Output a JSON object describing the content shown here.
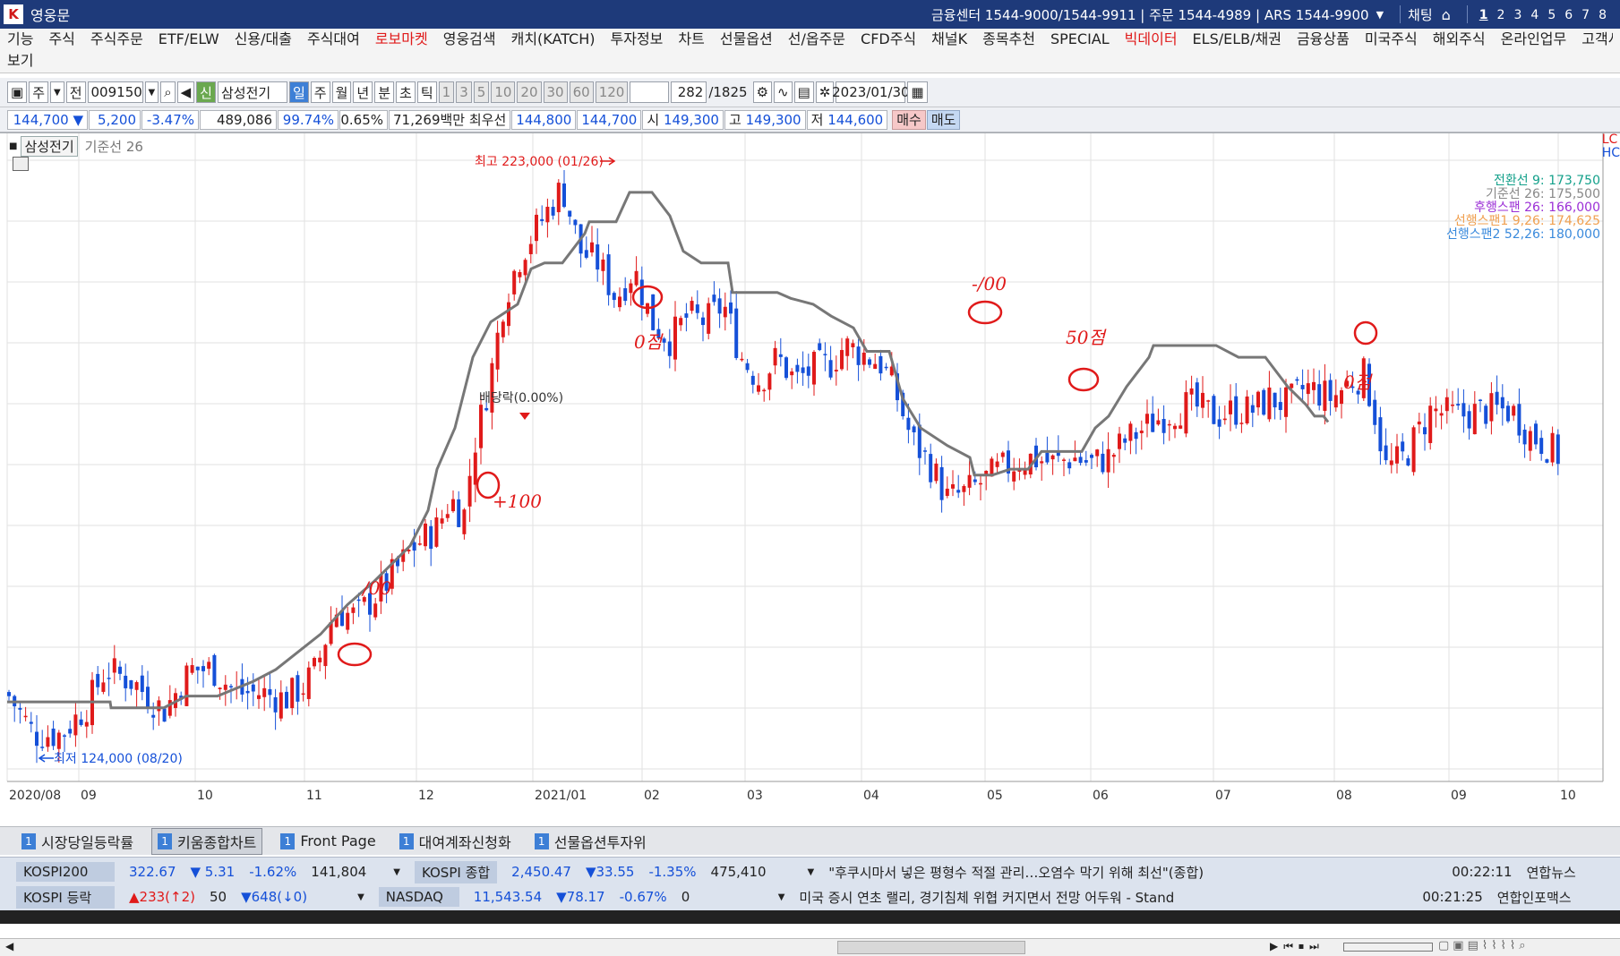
{
  "titlebar": {
    "app_icon": "kiwoom-logo-icon",
    "title": "영웅문",
    "center": "금융센터 1544-9000/1544-9911 | 주문 1544-4989 | ARS 1544-9900",
    "chat": "채팅",
    "home_icon": "home-icon",
    "screens": [
      "1",
      "2",
      "3",
      "4",
      "5",
      "6",
      "7",
      "8"
    ]
  },
  "menu": {
    "items": [
      "기능",
      "주식",
      "주식주문",
      "ETF/ELW",
      "신용/대출",
      "주식대여",
      "로보마켓",
      "영웅검색",
      "캐치(KATCH)",
      "투자정보",
      "차트",
      "선물옵션",
      "선/옵주문",
      "CFD주식",
      "채널K",
      "종목추천",
      "SPECIAL",
      "빅데이터",
      "ELS/ELB/채권",
      "금융상품",
      "미국주식",
      "해외주식",
      "온라인업무",
      "고객서비"
    ],
    "highlight": [
      "로보마켓",
      "빅데이터"
    ],
    "row2": "보기"
  },
  "toolbar": {
    "type": "주",
    "scope": "전",
    "code": "009150",
    "name": "삼성전기",
    "sin": "신",
    "periods": [
      "일",
      "주",
      "월",
      "년",
      "분",
      "초",
      "틱"
    ],
    "selected_period": "일",
    "intervals": [
      "1",
      "3",
      "5",
      "10",
      "20",
      "30",
      "60",
      "120"
    ],
    "count": "282",
    "total": "/1825",
    "date": "2023/01/30"
  },
  "quote": {
    "price": "144,700",
    "arrow": "▼",
    "change": "5,200",
    "pct": "-3.47%",
    "volume": "489,086",
    "ratio": "99.74%",
    "turnover": "0.65%",
    "amount": "71,269백만",
    "best_label": "최우선",
    "best_ask": "144,800",
    "best_bid": "144,700",
    "open_label": "시",
    "open": "149,300",
    "high_label": "고",
    "high": "149,300",
    "low_label": "저",
    "low": "144,600",
    "buy": "매수",
    "sell": "매도"
  },
  "chart_legend": {
    "name": "삼성전기",
    "indicator": "기준선 26"
  },
  "ichimoku": [
    {
      "label": "전환선 9: 173,750",
      "color": "#13a08a"
    },
    {
      "label": "기준선 26: 175,500",
      "color": "#888888"
    },
    {
      "label": "후행스팬 26: 166,000",
      "color": "#9b2fd6"
    },
    {
      "label": "선행스팬1 9,26: 174,625",
      "color": "#f0a050"
    },
    {
      "label": "선행스팬2 52,26: 180,000",
      "color": "#3a8adc"
    }
  ],
  "right_cut": [
    "LC",
    "HC"
  ],
  "chart_data": {
    "type": "line",
    "title": "",
    "x_labels": [
      "2020/08",
      "09",
      "10",
      "11",
      "12",
      "2021/01",
      "02",
      "03",
      "04",
      "05",
      "06",
      "07",
      "08",
      "09",
      "10"
    ],
    "high_annotation": "최고 223,000 (01/26)",
    "low_annotation": "최저 124,000 (08/20)",
    "dividend_annotation": "배당락(0.00%)",
    "series": [
      {
        "name": "기준선 26",
        "color": "#777777",
        "x": [
          0,
          60,
          80,
          115,
          116,
          130,
          150,
          175,
          200,
          235,
          275,
          300,
          325,
          350,
          380,
          410,
          450,
          470,
          480,
          500,
          520,
          540,
          570,
          585,
          600,
          620,
          645,
          650,
          660,
          680,
          695,
          705,
          720,
          740,
          755,
          775,
          805,
          810,
          830,
          840,
          860,
          875,
          900,
          920,
          945,
          960,
          985,
          1000,
          1020,
          1050,
          1075,
          1080,
          1100,
          1120,
          1140,
          1155,
          1200,
          1215,
          1230,
          1250,
          1275,
          1280,
          1300,
          1320,
          1350,
          1375,
          1405,
          1430,
          1450,
          1460,
          1470,
          1475
        ],
        "y": [
          131.5,
          131.5,
          131.5,
          131.5,
          130.5,
          130.5,
          130.5,
          130.5,
          132.5,
          132.5,
          135,
          137,
          140,
          143,
          148,
          152,
          158,
          164,
          171,
          178,
          190,
          196,
          199,
          205,
          206,
          206,
          211,
          213,
          213,
          213,
          218,
          218,
          218,
          214,
          208,
          206,
          206,
          201,
          201,
          201,
          201,
          200,
          199,
          197,
          195,
          191,
          191,
          183,
          178,
          175,
          173,
          170,
          170,
          171,
          171,
          174,
          174,
          178,
          180,
          185,
          190,
          192,
          192,
          192,
          192,
          190,
          190,
          185,
          182,
          180,
          180,
          179
        ]
      },
      {
        "name": "candles",
        "values": "daily OHLC approx"
      }
    ],
    "annotations_handwritten": [
      "/00",
      "+100",
      "0점",
      "-/00",
      "50점",
      "0점"
    ],
    "ylim": [
      118,
      228
    ]
  },
  "tabs": [
    {
      "num": "1",
      "label": "시장당일등락률"
    },
    {
      "num": "1",
      "label": "키움종합차트",
      "active": true
    },
    {
      "num": "1",
      "label": "Front Page"
    },
    {
      "num": "1",
      "label": "대여계좌신청화"
    },
    {
      "num": "1",
      "label": "선물옵션투자위"
    }
  ],
  "market": {
    "row1": {
      "label": "KOSPI200",
      "value": "322.67",
      "change": "▼ 5.31",
      "pct": "-1.62%",
      "vol": "141,804",
      "label2": "KOSPI 종합",
      "value2": "2,450.47",
      "change2": "▼33.55",
      "pct2": "-1.35%",
      "vol2": "475,410",
      "news": "\"후쿠시마서 넣은 평형수 적절 관리…오염수 막기 위해 최선\"(종합)",
      "time": "00:22:11",
      "source": "연합뉴스"
    },
    "row2": {
      "label": "KOSPI 등락",
      "up": "▲233(↑2)",
      "flat": "50",
      "down": "▼648(↓0)",
      "label2": "NASDAQ",
      "value2": "11,543.54",
      "change2": "▼78.17",
      "pct2": "-0.67%",
      "vol2": "0",
      "news": "미국 증시 연초 랠리, 경기침체 위협 커지면서 전망 어두워 - Stand",
      "time": "00:21:25",
      "source": "연합인포맥스"
    }
  },
  "colors": {
    "up": "#e01a1a",
    "down": "#1550d8",
    "titlebar": "#1e3a7a"
  }
}
